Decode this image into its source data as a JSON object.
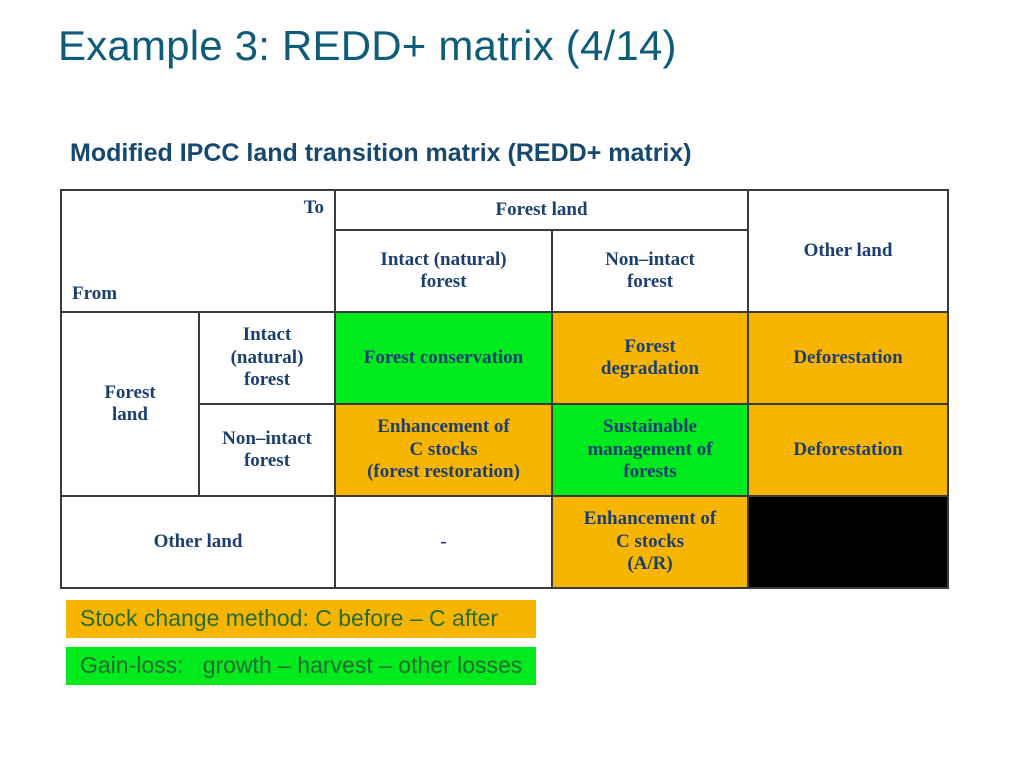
{
  "slide": {
    "title": "Example 3: REDD+ matrix (4/14)",
    "subtitle": "Modified IPCC land transition matrix (REDD+ matrix)",
    "title_color": "#0E5C78",
    "subtitle_color": "#17486F"
  },
  "matrix": {
    "axis_labels": {
      "to": "To",
      "from": "From"
    },
    "column_groups": [
      {
        "label": "Forest land",
        "span": 2
      },
      {
        "label": "Other land",
        "span": 1
      }
    ],
    "column_headers": [
      "Intact (natural)\nforest",
      "Non–intact\nforest",
      "Other land"
    ],
    "column_headers_display": {
      "intact_line1": "Intact (natural)",
      "intact_line2": "forest",
      "nonintact_line1": "Non–intact",
      "nonintact_line2": "forest",
      "otherland": "Other land"
    },
    "row_group_label": "Forest\nland",
    "row_group_label_display": {
      "line1": "Forest",
      "line2": "land"
    },
    "row_headers": [
      {
        "line1": "Intact",
        "line2": "(natural)",
        "line3": "forest"
      },
      {
        "line1": "Non–intact",
        "line2": "forest"
      },
      {
        "line1": "Other land"
      }
    ],
    "cells": {
      "r1c1": {
        "text": "Forest conservation",
        "color": "green"
      },
      "r1c2_line1": "Forest",
      "r1c2_line2": "degradation",
      "r1c3": {
        "text": "Deforestation",
        "color": "orange"
      },
      "r2c1_line1": "Enhancement of",
      "r2c1_line2": "C stocks",
      "r2c1_line3": "(forest restoration)",
      "r2c2_line1": "Sustainable",
      "r2c2_line2": "management of",
      "r2c2_line3": "forests",
      "r2c3": {
        "text": "Deforestation",
        "color": "orange"
      },
      "r3c1": {
        "text": "-",
        "color": "white"
      },
      "r3c2_line1": "Enhancement of",
      "r3c2_line2": "C stocks",
      "r3c2_line3": "(A/R)",
      "r3c3": {
        "text": "",
        "color": "black"
      }
    },
    "colors": {
      "green": "#00EA1E",
      "orange": "#F8B500",
      "black": "#000000",
      "white": "#FFFFFF",
      "border": "#3A3A3A",
      "text": "#1C3F70"
    }
  },
  "legend": {
    "items": [
      {
        "label": "Stock change method: C before – C after",
        "color": "#F8B500"
      },
      {
        "label": "Gain-loss:   growth – harvest – other losses",
        "color": "#00EA1E"
      }
    ],
    "text_color": "#256B33"
  }
}
